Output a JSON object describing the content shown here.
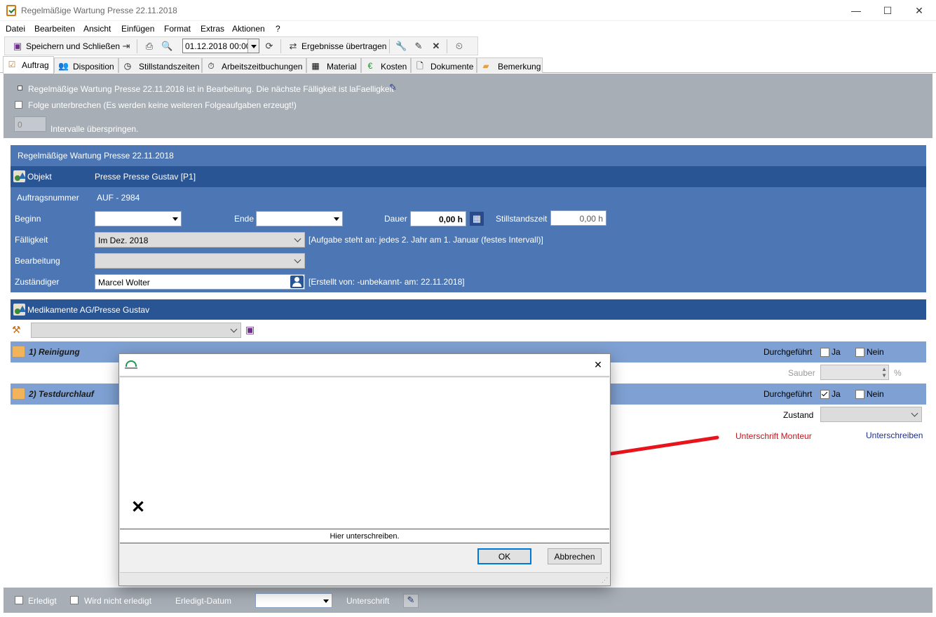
{
  "window": {
    "title": "Regelmäßige Wartung Presse 22.11.2018",
    "minimize": "—",
    "maximize": "☐",
    "close": "✕"
  },
  "menu": [
    "Datei",
    "Bearbeiten",
    "Ansicht",
    "Einfügen",
    "Format",
    "Extras",
    "Aktionen",
    "?"
  ],
  "toolbar": {
    "save_close_label": "Speichern und Schließen",
    "date_value": "01.12.2018 00:00",
    "transfer_label": "Ergebnisse übertragen"
  },
  "tabs": [
    "Auftrag",
    "Disposition",
    "Stillstandszeiten",
    "Arbeitszeitbuchungen",
    "Material",
    "Kosten",
    "Dokumente",
    "Bemerkung"
  ],
  "status": {
    "in_progress_text": "Regelmäßige Wartung Presse 22.11.2018 ist in Bearbeitung. Die nächste Fälligkeit ist laFaelligkeit",
    "break_sequence_label": "Folge unterbrechen (Es werden keine weiteren Folgeaufgaben erzeugt!)",
    "skip_value": "0",
    "skip_label": "Intervalle überspringen."
  },
  "order": {
    "header": "Regelmäßige Wartung Presse 22.11.2018",
    "object_label": "Objekt",
    "object_value": "Presse Presse Gustav [P1]",
    "order_number_label": "Auftragsnummer",
    "order_number_value": "AUF - 2984",
    "start_label": "Beginn",
    "end_label": "Ende",
    "duration_label": "Dauer",
    "duration_value": "0,00 h",
    "downtime_label": "Stillstandszeit",
    "downtime_value": "0,00 h",
    "due_label": "Fälligkeit",
    "due_value": "Im Dez. 2018",
    "due_note": "[Aufgabe steht an: jedes 2. Jahr am 1. Januar (festes Intervall)]",
    "processing_label": "Bearbeitung",
    "responsible_label": "Zuständiger",
    "responsible_value": "Marcel Wolter",
    "created_note": "[Erstellt von: -unbekannt- am: 22.11.2018]"
  },
  "checklist": {
    "header": "Medikamente AG/Presse Gustav",
    "steps": [
      {
        "name": "1) Reinigung",
        "done_label": "Durchgeführt",
        "yes": "Ja",
        "no": "Nein",
        "extra_label": "Sauber",
        "unit": "%"
      },
      {
        "name": "2) Testdurchlauf",
        "done_label": "Durchgeführt",
        "yes": "Ja",
        "no": "Nein",
        "extra_label": "Zustand",
        "sign_label": "Unterschrift Monteur",
        "sign_link": "Unterschreiben"
      }
    ]
  },
  "bottom": {
    "done_label": "Erledigt",
    "not_done_label": "Wird nicht erledigt",
    "done_date_label": "Erledigt-Datum",
    "signature_label": "Unterschrift"
  },
  "dialog": {
    "close": "✕",
    "x_mark": "✕",
    "hint": "Hier unterschreiben.",
    "ok": "OK",
    "cancel": "Abbrechen"
  },
  "colors": {
    "panel_blue": "#4c77b4",
    "band_dark": "#2a5595",
    "step_blue": "#7ea0d2",
    "status_grey": "#a7aeb6",
    "annotation_arrow": "#e8141c",
    "warning_red": "#c0161c"
  }
}
